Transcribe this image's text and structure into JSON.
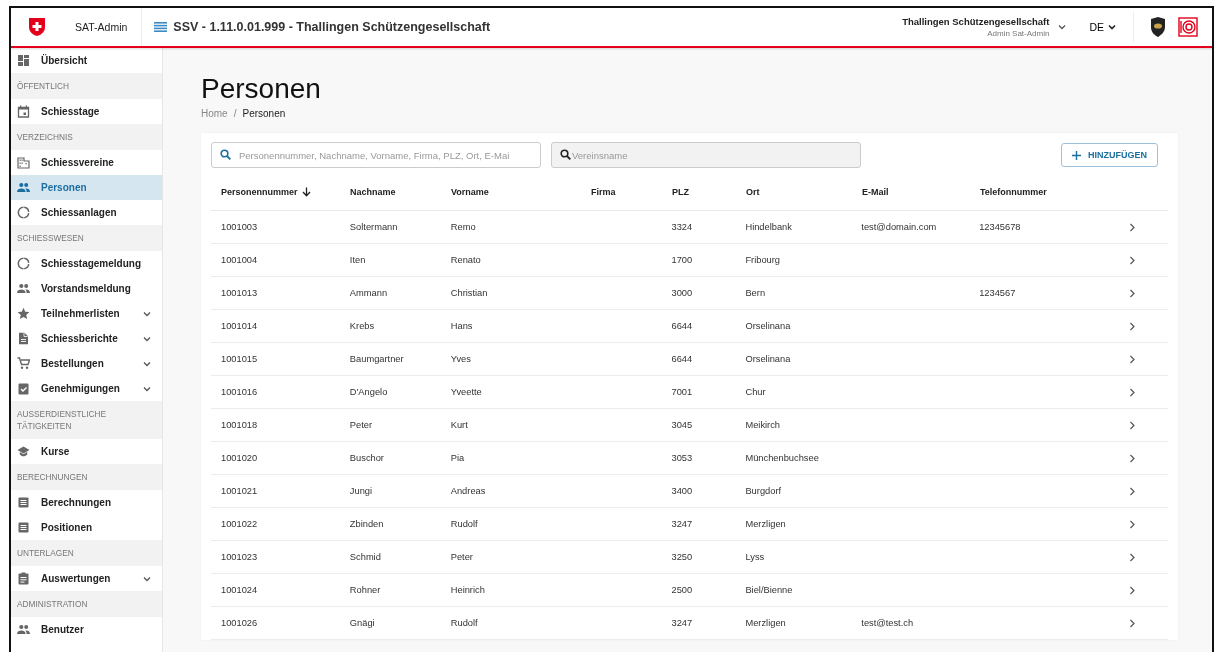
{
  "header": {
    "app_name": "SAT-Admin",
    "title": "SSV - 1.11.0.01.999 - Thallingen Schützengesellschaft",
    "organization": "Thallingen Schützengesellschaft",
    "user": "Admin Sat-Admin",
    "language": "DE"
  },
  "sidebar": {
    "items": [
      {
        "kind": "link",
        "label": "Übersicht",
        "selected": false,
        "expandable": false
      },
      {
        "kind": "section",
        "label": "ÖFFENTLICH"
      },
      {
        "kind": "link",
        "label": "Schiesstage",
        "selected": false,
        "expandable": false
      },
      {
        "kind": "section",
        "label": "VERZEICHNIS"
      },
      {
        "kind": "link",
        "label": "Schiessvereine",
        "selected": false,
        "expandable": false
      },
      {
        "kind": "link",
        "label": "Personen",
        "selected": true,
        "expandable": false
      },
      {
        "kind": "link",
        "label": "Schiessanlagen",
        "selected": false,
        "expandable": false
      },
      {
        "kind": "section",
        "label": "SCHIESSWESEN"
      },
      {
        "kind": "link",
        "label": "Schiesstagemeldung",
        "selected": false,
        "expandable": false
      },
      {
        "kind": "link",
        "label": "Vorstandsmeldung",
        "selected": false,
        "expandable": false
      },
      {
        "kind": "link",
        "label": "Teilnehmerlisten",
        "selected": false,
        "expandable": true
      },
      {
        "kind": "link",
        "label": "Schiessberichte",
        "selected": false,
        "expandable": true
      },
      {
        "kind": "link",
        "label": "Bestellungen",
        "selected": false,
        "expandable": true
      },
      {
        "kind": "link",
        "label": "Genehmigungen",
        "selected": false,
        "expandable": true
      },
      {
        "kind": "section",
        "label": "AUSSERDIENSTLICHE TÄTIGKEITEN"
      },
      {
        "kind": "link",
        "label": "Kurse",
        "selected": false,
        "expandable": false
      },
      {
        "kind": "section",
        "label": "BERECHNUNGEN"
      },
      {
        "kind": "link",
        "label": "Berechnungen",
        "selected": false,
        "expandable": false
      },
      {
        "kind": "link",
        "label": "Positionen",
        "selected": false,
        "expandable": false
      },
      {
        "kind": "section",
        "label": "UNTERLAGEN"
      },
      {
        "kind": "link",
        "label": "Auswertungen",
        "selected": false,
        "expandable": true
      },
      {
        "kind": "section",
        "label": "ADMINISTRATION"
      },
      {
        "kind": "link",
        "label": "Benutzer",
        "selected": false,
        "expandable": false
      }
    ]
  },
  "page": {
    "title": "Personen",
    "breadcrumb": [
      "Home",
      "Personen"
    ],
    "breadcrumb_separator": "/"
  },
  "search": {
    "placeholder": "Personennummer, Nachname, Vorname, Firma, PLZ, Ort, E-Mai"
  },
  "club_filter": {
    "placeholder": "Vereinsname"
  },
  "add_button": {
    "label": "HINZUFÜGEN"
  },
  "table": {
    "columns": [
      {
        "label": "Personennummer",
        "sorted": true
      },
      {
        "label": "Nachname",
        "sorted": false
      },
      {
        "label": "Vorname",
        "sorted": false
      },
      {
        "label": "Firma",
        "sorted": false
      },
      {
        "label": "PLZ",
        "sorted": false
      },
      {
        "label": "Ort",
        "sorted": false
      },
      {
        "label": "E-Mail",
        "sorted": false
      },
      {
        "label": "Telefonnummer",
        "sorted": false
      }
    ],
    "rows": [
      [
        "1001003",
        "Soltermann",
        "Remo",
        "",
        "3324",
        "Hindelbank",
        "test@domain.com",
        "12345678"
      ],
      [
        "1001004",
        "Iten",
        "Renato",
        "",
        "1700",
        "Fribourg",
        "",
        ""
      ],
      [
        "1001013",
        "Ammann",
        "Christian",
        "",
        "3000",
        "Bern",
        "",
        "1234567"
      ],
      [
        "1001014",
        "Krebs",
        "Hans",
        "",
        "6644",
        "Orselinana",
        "",
        ""
      ],
      [
        "1001015",
        "Baumgartner",
        "Yves",
        "",
        "6644",
        "Orselinana",
        "",
        ""
      ],
      [
        "1001016",
        "D'Angelo",
        "Yveette",
        "",
        "7001",
        "Chur",
        "",
        ""
      ],
      [
        "1001018",
        "Peter",
        "Kurt",
        "",
        "3045",
        "Meikirch",
        "",
        ""
      ],
      [
        "1001020",
        "Buschor",
        "Pia",
        "",
        "3053",
        "Münchenbuchsee",
        "",
        ""
      ],
      [
        "1001021",
        "Jungi",
        "Andreas",
        "",
        "3400",
        "Burgdorf",
        "",
        ""
      ],
      [
        "1001022",
        "Zbinden",
        "Rudolf",
        "",
        "3247",
        "Merzligen",
        "",
        ""
      ],
      [
        "1001023",
        "Schmid",
        "Peter",
        "",
        "3250",
        "Lyss",
        "",
        ""
      ],
      [
        "1001024",
        "Rohner",
        "Heinrich",
        "",
        "2500",
        "Biel/Bienne",
        "",
        ""
      ],
      [
        "1001026",
        "Gnägi",
        "Rudolf",
        "",
        "3247",
        "Merzligen",
        "test@test.ch",
        ""
      ]
    ]
  }
}
